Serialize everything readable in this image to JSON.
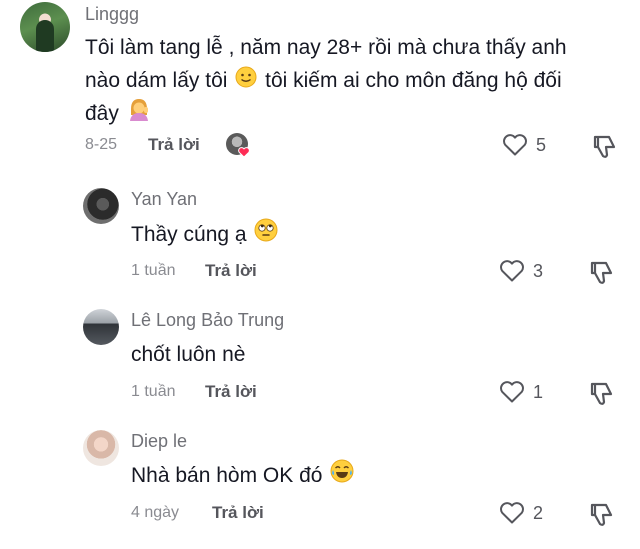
{
  "comments": [
    {
      "username": "Linggg",
      "text_line1": "Tôi làm tang lễ , năm nay 28+ rồi mà chưa thấy anh",
      "text_line2a": "nào dám lấy tôi",
      "text_line2b": "tôi kiếm ai cho môn đăng hộ đối",
      "text_line3": "đây",
      "date": "8-25",
      "reply_label": "Trả lời",
      "likes": "5"
    },
    {
      "username": "Yan Yan",
      "text": "Thầy cúng ạ",
      "date": "1 tuần",
      "reply_label": "Trả lời",
      "likes": "3"
    },
    {
      "username": "Lê Long Bảo Trung",
      "text": "chốt luôn nè",
      "date": "1 tuần",
      "reply_label": "Trả lời",
      "likes": "1"
    },
    {
      "username": "Diep le",
      "text": "Nhà bán hòm OK đó",
      "date": "4 ngày",
      "reply_label": "Trả lời",
      "likes": "2"
    }
  ],
  "icons": {
    "heart": "heart-outline-icon",
    "dislike": "thumbs-down-icon",
    "emoji_smile": "slightly-smiling-face",
    "emoji_woman": "woman-tipping-hand",
    "emoji_eyeroll": "face-with-rolling-eyes",
    "emoji_laugh": "face-with-tears-of-joy",
    "creator_like": "creator-liked-heart"
  },
  "colors": {
    "text": "#161823",
    "muted": "#8a8b91",
    "creator_heart": "#fe2c55"
  }
}
